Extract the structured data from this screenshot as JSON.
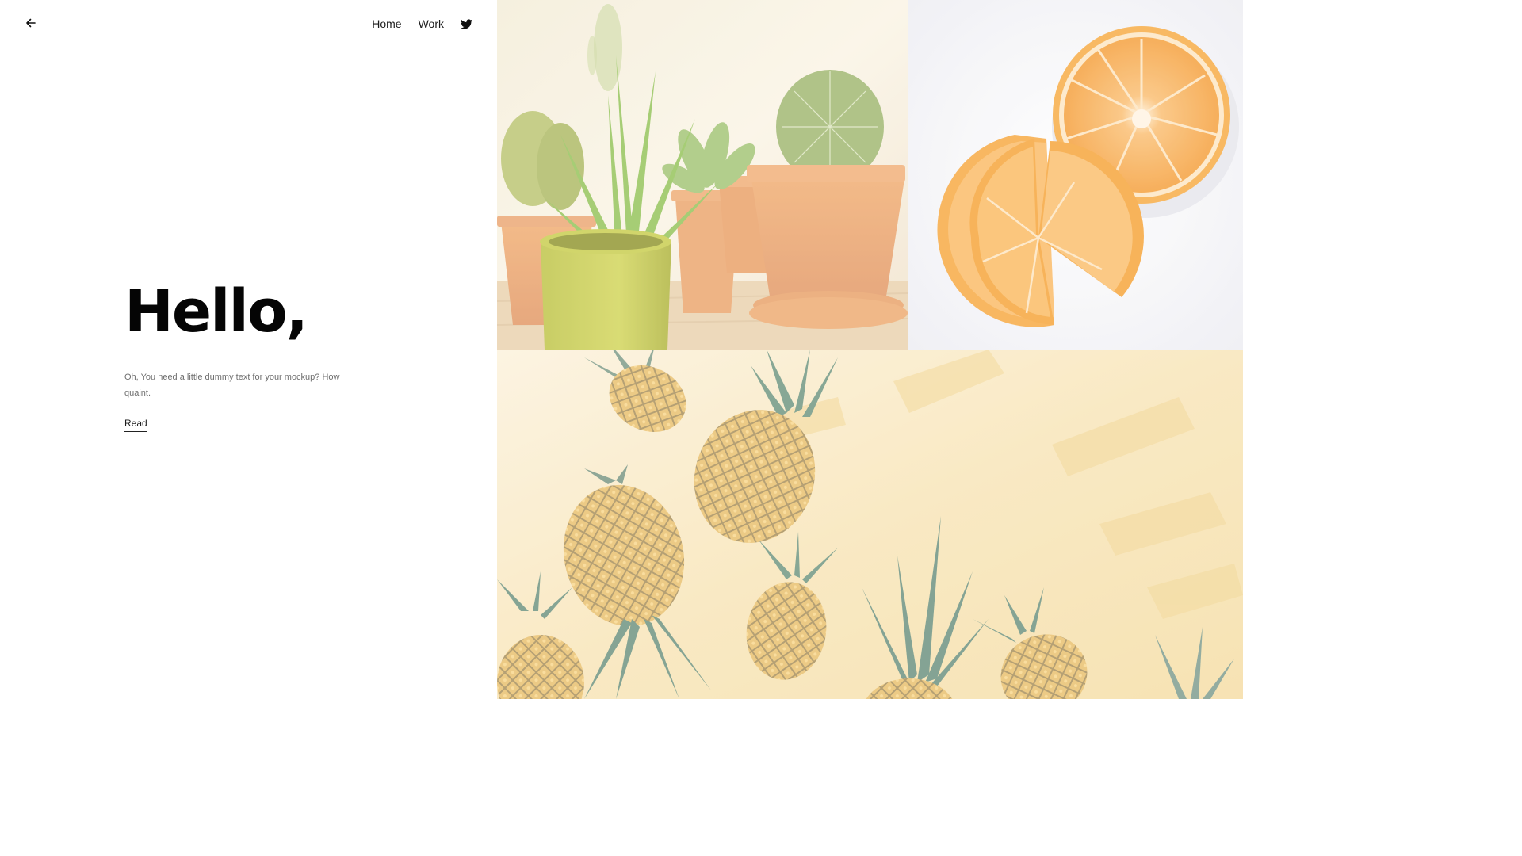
{
  "nav": {
    "back_icon": "arrow-left-icon",
    "links": [
      {
        "label": "Home"
      },
      {
        "label": "Work"
      }
    ],
    "social_icon": "twitter-icon"
  },
  "hero": {
    "title": "Hello,",
    "body": "Oh, You need a little dummy text for your mockup? How quaint.",
    "link_label": "Read"
  },
  "gallery": {
    "images": [
      {
        "subject": "potted cacti and succulents in terracotta pots"
      },
      {
        "subject": "sliced orange halves on white"
      },
      {
        "subject": "pineapples on yellow painted background"
      }
    ]
  },
  "colors": {
    "text_dark": "#050505",
    "text_muted": "#6f6f6f",
    "terracotta": "#e9a265",
    "orange": "#f6a84a",
    "yellow_bg": "#f7e3b2"
  }
}
